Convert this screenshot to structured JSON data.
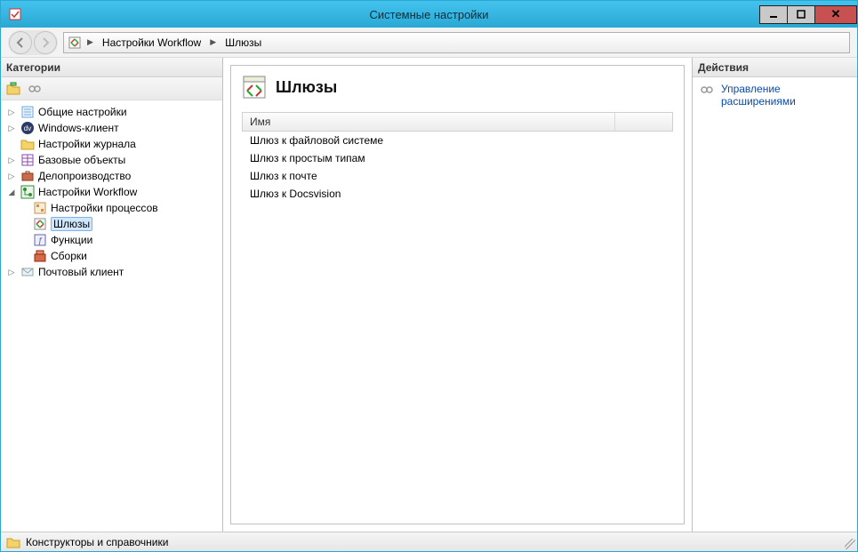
{
  "window": {
    "title": "Системные настройки"
  },
  "breadcrumb": {
    "root": "Настройки Workflow",
    "leaf": "Шлюзы"
  },
  "left_panel": {
    "header": "Категории",
    "tree": {
      "general": "Общие настройки",
      "winclient": "Windows-клиент",
      "journal": "Настройки журнала",
      "baseobjects": "Базовые объекты",
      "workflow": "Делопроизводство",
      "wf_settings": "Настройки Workflow",
      "wf_processes": "Настройки процессов",
      "wf_gateways": "Шлюзы",
      "wf_functions": "Функции",
      "wf_assemblies": "Сборки",
      "mailclient": "Почтовый клиент"
    }
  },
  "center": {
    "title": "Шлюзы",
    "column_name": "Имя",
    "items": [
      "Шлюз к файловой системе",
      "Шлюз к простым типам",
      "Шлюз к почте",
      "Шлюз к Docsvision"
    ]
  },
  "right_panel": {
    "header": "Действия",
    "action_manage_ext": "Управление расширениями"
  },
  "status": {
    "text": "Конструкторы и справочники"
  }
}
